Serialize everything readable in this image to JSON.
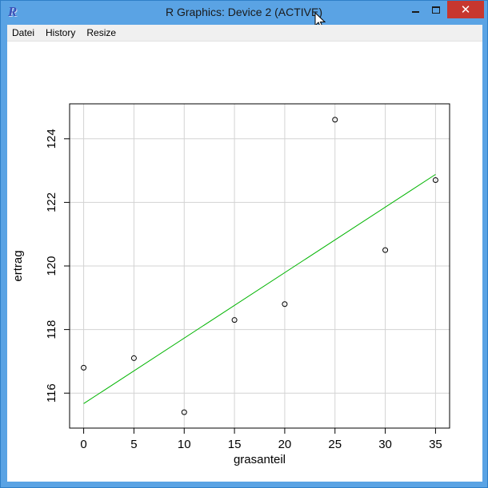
{
  "window": {
    "title": "R Graphics: Device 2 (ACTIVE)",
    "app_icon": "R",
    "minimize_icon": "minimize-icon",
    "maximize_icon": "maximize-icon",
    "close_icon": "close-icon"
  },
  "menu": {
    "items": [
      {
        "label": "Datei"
      },
      {
        "label": "History"
      },
      {
        "label": "Resize"
      }
    ]
  },
  "colors": {
    "titlebar": "#5aa3e4",
    "close_button": "#c7372f",
    "regression_line": "#00b400",
    "grid": "#d3d3d3"
  },
  "chart_data": {
    "type": "scatter",
    "title": "",
    "xlabel": "grasanteil",
    "ylabel": "ertrag",
    "xlim": [
      -1.4,
      36.4
    ],
    "ylim": [
      114.9,
      125.1
    ],
    "xticks": [
      0,
      5,
      10,
      15,
      20,
      25,
      30,
      35
    ],
    "yticks": [
      116,
      118,
      120,
      122,
      124
    ],
    "grid": true,
    "points": [
      {
        "x": 0,
        "y": 116.8
      },
      {
        "x": 5,
        "y": 117.1
      },
      {
        "x": 10,
        "y": 115.4
      },
      {
        "x": 15,
        "y": 118.3
      },
      {
        "x": 20,
        "y": 118.8
      },
      {
        "x": 25,
        "y": 124.6
      },
      {
        "x": 30,
        "y": 120.5
      },
      {
        "x": 35,
        "y": 122.7
      }
    ],
    "fit_line": {
      "x": [
        0,
        35
      ],
      "y": [
        115.67,
        122.88
      ],
      "color": "#00b400"
    }
  }
}
